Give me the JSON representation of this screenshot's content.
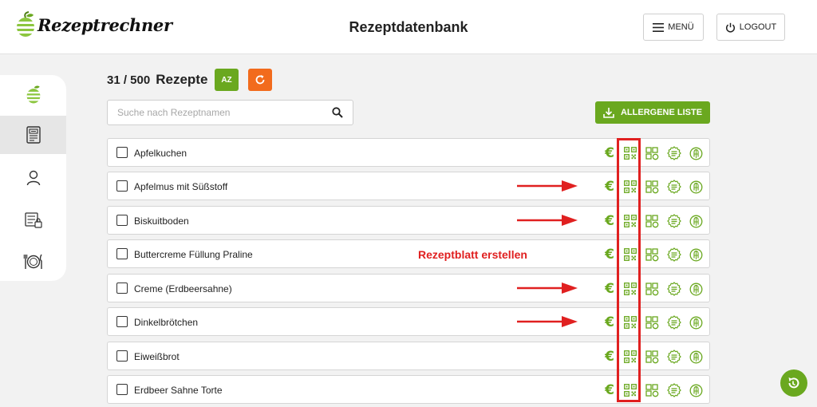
{
  "header": {
    "logo_text": "Rezeptrechner",
    "title": "Rezeptdatenbank",
    "menu_label": "MENÜ",
    "logout_label": "LOGOUT"
  },
  "sidebar": {
    "items": [
      {
        "icon": "apple-logo-icon"
      },
      {
        "icon": "recipe-sheet-icon",
        "active": true
      },
      {
        "icon": "user-icon"
      },
      {
        "icon": "list-lock-icon"
      },
      {
        "icon": "plate-cutlery-icon"
      }
    ]
  },
  "toolbar": {
    "count": "31 / 500",
    "count_label": "Rezepte",
    "sort_label": "AZ",
    "search_placeholder": "Suche nach Rezeptnamen",
    "allergen_label": "ALLERGENE LISTE"
  },
  "recipes": [
    {
      "name": "Apfelkuchen",
      "arrow": false
    },
    {
      "name": "Apfelmus mit Süßstoff",
      "arrow": true
    },
    {
      "name": "Biskuitboden",
      "arrow": true
    },
    {
      "name": "Buttercreme Füllung Praline",
      "arrow": false
    },
    {
      "name": "Creme (Erdbeersahne)",
      "arrow": true
    },
    {
      "name": "Dinkelbrötchen",
      "arrow": true
    },
    {
      "name": "Eiweißbrot",
      "arrow": false
    },
    {
      "name": "Erdbeer Sahne Torte",
      "arrow": false
    }
  ],
  "row_icons": {
    "euro": "€",
    "names": [
      "euro-price-icon",
      "qr-code-icon",
      "ingredients-icon",
      "allergen-icon",
      "nutrition-icon"
    ]
  },
  "annotation": {
    "callout": "Rezeptblatt erstellen"
  },
  "colors": {
    "accent_green": "#6aa81f",
    "accent_orange": "#f26b1d",
    "annotation_red": "#e02020"
  }
}
